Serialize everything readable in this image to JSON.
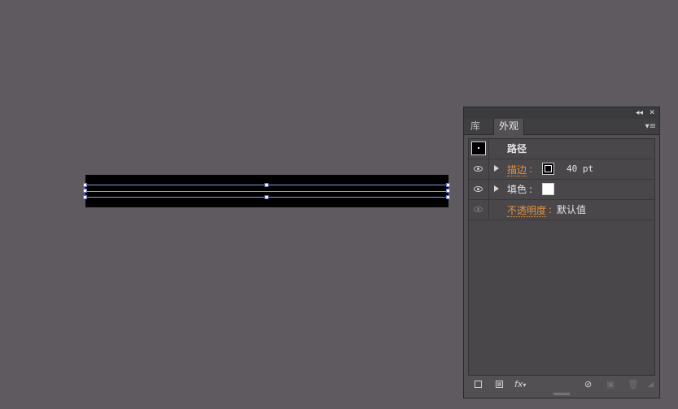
{
  "panel": {
    "topbar": {
      "collapse_glyph": "◂◂",
      "close_glyph": "✕"
    },
    "tabs": [
      {
        "label": "库",
        "active": false
      },
      {
        "label": "外观",
        "active": true
      }
    ],
    "menu_glyph": "▾≡",
    "rows": {
      "path": {
        "label": "路径"
      },
      "stroke": {
        "label": "描边",
        "colon": ":",
        "value": "40 pt",
        "swatch_color": "#000000"
      },
      "fill": {
        "label": "填色",
        "colon": ":",
        "swatch_color": "#ffffff"
      },
      "opacity": {
        "label": "不透明度",
        "colon": ":",
        "value": "默认值"
      }
    },
    "bottom_tools": {
      "fx_label": "fx"
    }
  },
  "colors": {
    "canvas": "#5e5a5f",
    "artwork": "#000000",
    "link": "#e8913a",
    "path_line": "#8a9ad8"
  }
}
